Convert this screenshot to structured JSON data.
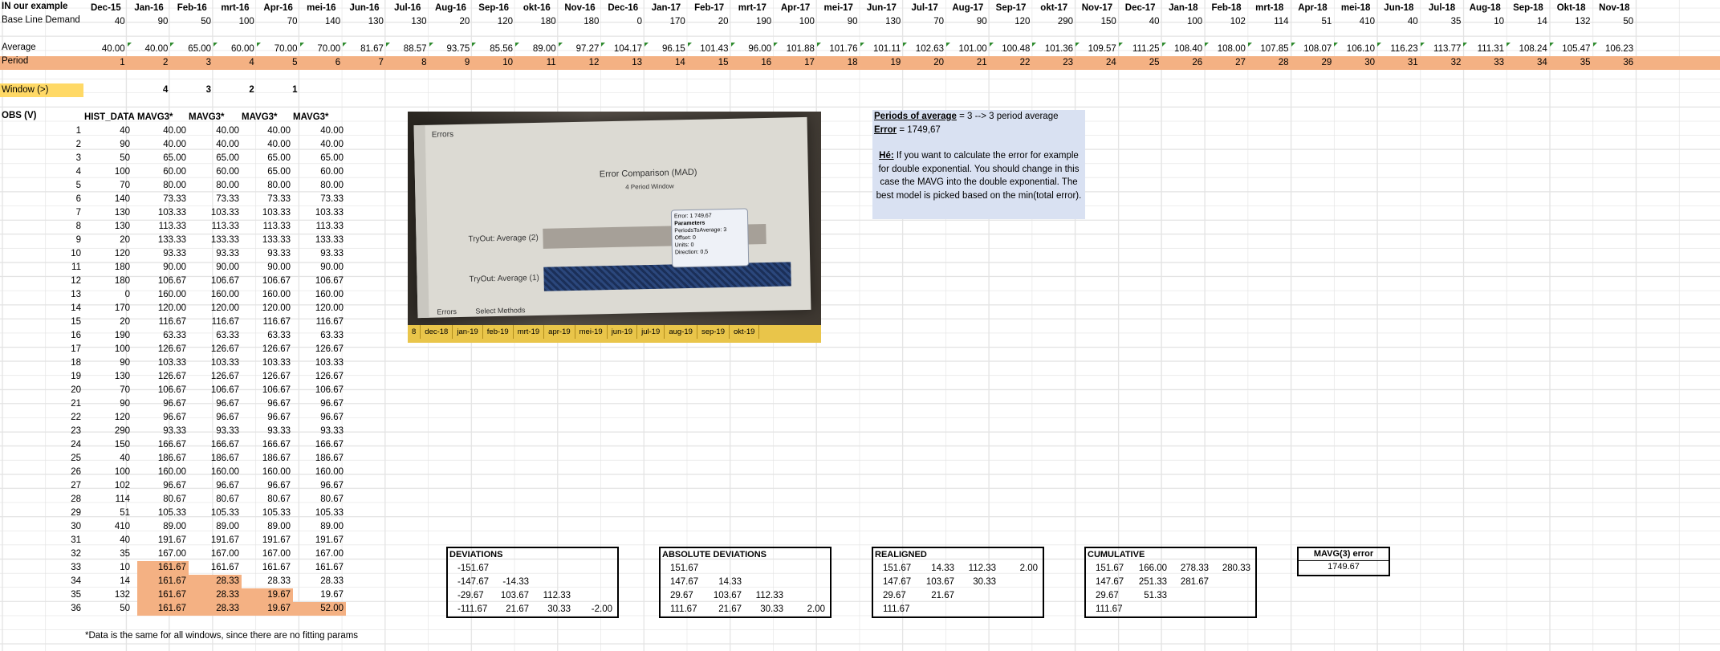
{
  "top": {
    "label_a1": "IN our example",
    "months": [
      "Dec-15",
      "Jan-16",
      "Feb-16",
      "mrt-16",
      "Apr-16",
      "mei-16",
      "Jun-16",
      "Jul-16",
      "Aug-16",
      "Sep-16",
      "okt-16",
      "Nov-16",
      "Dec-16",
      "Jan-17",
      "Feb-17",
      "mrt-17",
      "Apr-17",
      "mei-17",
      "Jun-17",
      "Jul-17",
      "Aug-17",
      "Sep-17",
      "okt-17",
      "Nov-17",
      "Dec-17",
      "Jan-18",
      "Feb-18",
      "mrt-18",
      "Apr-18",
      "mei-18",
      "Jun-18",
      "Jul-18",
      "Aug-18",
      "Sep-18",
      "Okt-18",
      "Nov-18"
    ],
    "demand_label": "Base Line Demand",
    "demand": [
      "40",
      "90",
      "50",
      "100",
      "70",
      "140",
      "130",
      "130",
      "20",
      "120",
      "180",
      "180",
      "0",
      "170",
      "20",
      "190",
      "100",
      "90",
      "130",
      "70",
      "90",
      "120",
      "290",
      "150",
      "40",
      "100",
      "102",
      "114",
      "51",
      "410",
      "40",
      "35",
      "10",
      "14",
      "132",
      "50"
    ],
    "average_label": "Average",
    "average": [
      "40.00",
      "40.00",
      "65.00",
      "60.00",
      "70.00",
      "70.00",
      "81.67",
      "88.57",
      "93.75",
      "85.56",
      "89.00",
      "97.27",
      "104.17",
      "96.15",
      "101.43",
      "96.00",
      "101.88",
      "101.76",
      "101.11",
      "102.63",
      "101.00",
      "100.48",
      "101.36",
      "109.57",
      "111.25",
      "108.40",
      "108.00",
      "107.85",
      "108.07",
      "106.10",
      "116.23",
      "113.77",
      "111.31",
      "108.24",
      "105.47",
      "106.23"
    ],
    "period_label": "Period",
    "periods": [
      "1",
      "2",
      "3",
      "4",
      "5",
      "6",
      "7",
      "8",
      "9",
      "10",
      "11",
      "12",
      "13",
      "14",
      "15",
      "16",
      "17",
      "18",
      "19",
      "20",
      "21",
      "22",
      "23",
      "24",
      "25",
      "26",
      "27",
      "28",
      "29",
      "30",
      "31",
      "32",
      "33",
      "34",
      "35",
      "36"
    ],
    "window_label": "Window (>)",
    "window_values": [
      "4",
      "3",
      "2",
      "1"
    ]
  },
  "table": {
    "obs_label": "OBS (V)",
    "headers": [
      "HIST_DATA",
      "MAVG3*",
      "MAVG3*",
      "MAVG3*",
      "MAVG3*"
    ],
    "rows": [
      [
        "1",
        "40",
        "40.00",
        "40.00",
        "40.00",
        "40.00"
      ],
      [
        "2",
        "90",
        "40.00",
        "40.00",
        "40.00",
        "40.00"
      ],
      [
        "3",
        "50",
        "65.00",
        "65.00",
        "65.00",
        "65.00"
      ],
      [
        "4",
        "100",
        "60.00",
        "60.00",
        "65.00",
        "60.00"
      ],
      [
        "5",
        "70",
        "80.00",
        "80.00",
        "80.00",
        "80.00"
      ],
      [
        "6",
        "140",
        "73.33",
        "73.33",
        "73.33",
        "73.33"
      ],
      [
        "7",
        "130",
        "103.33",
        "103.33",
        "103.33",
        "103.33"
      ],
      [
        "8",
        "130",
        "113.33",
        "113.33",
        "113.33",
        "113.33"
      ],
      [
        "9",
        "20",
        "133.33",
        "133.33",
        "133.33",
        "133.33"
      ],
      [
        "10",
        "120",
        "93.33",
        "93.33",
        "93.33",
        "93.33"
      ],
      [
        "11",
        "180",
        "90.00",
        "90.00",
        "90.00",
        "90.00"
      ],
      [
        "12",
        "180",
        "106.67",
        "106.67",
        "106.67",
        "106.67"
      ],
      [
        "13",
        "0",
        "160.00",
        "160.00",
        "160.00",
        "160.00"
      ],
      [
        "14",
        "170",
        "120.00",
        "120.00",
        "120.00",
        "120.00"
      ],
      [
        "15",
        "20",
        "116.67",
        "116.67",
        "116.67",
        "116.67"
      ],
      [
        "16",
        "190",
        "63.33",
        "63.33",
        "63.33",
        "63.33"
      ],
      [
        "17",
        "100",
        "126.67",
        "126.67",
        "126.67",
        "126.67"
      ],
      [
        "18",
        "90",
        "103.33",
        "103.33",
        "103.33",
        "103.33"
      ],
      [
        "19",
        "130",
        "126.67",
        "126.67",
        "126.67",
        "126.67"
      ],
      [
        "20",
        "70",
        "106.67",
        "106.67",
        "106.67",
        "106.67"
      ],
      [
        "21",
        "90",
        "96.67",
        "96.67",
        "96.67",
        "96.67"
      ],
      [
        "22",
        "120",
        "96.67",
        "96.67",
        "96.67",
        "96.67"
      ],
      [
        "23",
        "290",
        "93.33",
        "93.33",
        "93.33",
        "93.33"
      ],
      [
        "24",
        "150",
        "166.67",
        "166.67",
        "166.67",
        "166.67"
      ],
      [
        "25",
        "40",
        "186.67",
        "186.67",
        "186.67",
        "186.67"
      ],
      [
        "26",
        "100",
        "160.00",
        "160.00",
        "160.00",
        "160.00"
      ],
      [
        "27",
        "102",
        "96.67",
        "96.67",
        "96.67",
        "96.67"
      ],
      [
        "28",
        "114",
        "80.67",
        "80.67",
        "80.67",
        "80.67"
      ],
      [
        "29",
        "51",
        "105.33",
        "105.33",
        "105.33",
        "105.33"
      ],
      [
        "30",
        "410",
        "89.00",
        "89.00",
        "89.00",
        "89.00"
      ],
      [
        "31",
        "40",
        "191.67",
        "191.67",
        "191.67",
        "191.67"
      ],
      [
        "32",
        "35",
        "167.00",
        "167.00",
        "167.00",
        "167.00"
      ],
      [
        "33",
        "10",
        "161.67",
        "161.67",
        "161.67",
        "161.67"
      ],
      [
        "34",
        "14",
        "161.67",
        "28.33",
        "28.33",
        "28.33"
      ],
      [
        "35",
        "132",
        "161.67",
        "28.33",
        "19.67",
        "19.67"
      ],
      [
        "36",
        "50",
        "161.67",
        "28.33",
        "19.67",
        "52.00"
      ]
    ],
    "footnote": "*Data is the same for all windows, since there are no fitting params"
  },
  "photo": {
    "window_title": "Errors",
    "chart_title": "Error Comparison (MAD)",
    "subtitle": "4 Period Window",
    "bar_label_2": "TryOut: Average (2)",
    "bar_label_1": "TryOut: Average (1)",
    "tooltip_lines": [
      "Error: 1 749,67",
      "Parameters",
      "PeriodsToAverage: 3",
      "Offset: 0",
      "Units: 0",
      "Direction: 0,5"
    ],
    "bottom_tab_errors": "Errors",
    "bottom_tab_methods": "Select Methods",
    "sheet_tabs": [
      "8",
      "dec-18",
      "jan-19",
      "feb-19",
      "mrt-19",
      "apr-19",
      "mei-19",
      "jun-19",
      "jul-19",
      "aug-19",
      "sep-19",
      "okt-19"
    ]
  },
  "note": {
    "line1_label": "Periods of average",
    "line1_value": " = 3 --> 3 period average",
    "line2_label": "Error",
    "line2_value": " = 1749,67",
    "he_label": "Hé:",
    "he_text": " If you want to calculate the error for example for double exponential. You should change in this case the MAVG into the double exponential. The best model is picked based on the min(total error)."
  },
  "deviations": {
    "title": "DEVIATIONS",
    "rows": [
      [
        "-151.67",
        "",
        "",
        ""
      ],
      [
        "-147.67",
        "-14.33",
        "",
        ""
      ],
      [
        "-29.67",
        "103.67",
        "112.33",
        ""
      ],
      [
        "-111.67",
        "21.67",
        "30.33",
        "-2.00"
      ]
    ]
  },
  "abs_deviations": {
    "title": "ABSOLUTE DEVIATIONS",
    "rows": [
      [
        "151.67",
        "",
        "",
        ""
      ],
      [
        "147.67",
        "14.33",
        "",
        ""
      ],
      [
        "29.67",
        "103.67",
        "112.33",
        ""
      ],
      [
        "111.67",
        "21.67",
        "30.33",
        "2.00"
      ]
    ]
  },
  "realigned": {
    "title": "REALIGNED",
    "rows": [
      [
        "151.67",
        "14.33",
        "112.33",
        "2.00"
      ],
      [
        "147.67",
        "103.67",
        "30.33",
        ""
      ],
      [
        "29.67",
        "21.67",
        "",
        ""
      ],
      [
        "111.67",
        "",
        "",
        ""
      ]
    ]
  },
  "cumulative": {
    "title": "CUMULATIVE",
    "rows": [
      [
        "151.67",
        "166.00",
        "278.33",
        "280.33"
      ],
      [
        "147.67",
        "251.33",
        "281.67",
        ""
      ],
      [
        "29.67",
        "51.33",
        "",
        ""
      ],
      [
        "111.67",
        "",
        "",
        ""
      ]
    ]
  },
  "mavg_error": {
    "title": "MAVG(3) error",
    "value": "1749.67"
  },
  "colors": {
    "peach": "#f4b183",
    "yellow": "#ffd966",
    "note_bg": "#d9e1f2",
    "comment_marker": "#2e8b2e"
  }
}
